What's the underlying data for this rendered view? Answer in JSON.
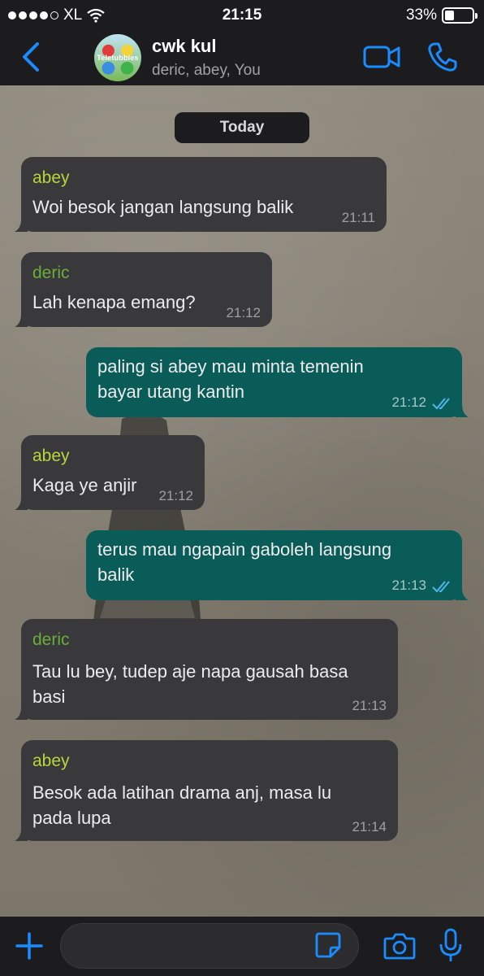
{
  "status_bar": {
    "carrier": "XL",
    "time": "21:15",
    "battery_percent": "33%",
    "battery_level": 0.33,
    "signal_bars": 4,
    "icons": [
      "signal-dots-icon",
      "wifi-icon",
      "battery-icon"
    ]
  },
  "header": {
    "back_icon": "chevron-left-icon",
    "avatar_text": "Teletubbies",
    "title": "cwk kul",
    "subtitle": "deric, abey, You",
    "video_icon": "video-camera-icon",
    "call_icon": "phone-icon"
  },
  "date_divider": "Today",
  "messages": [
    {
      "direction": "in",
      "sender": "abey",
      "sender_color": "#b7d63b",
      "text_lines": [
        "Woi besok jangan langsung balik"
      ],
      "time": "21:11"
    },
    {
      "direction": "in",
      "sender": "deric",
      "sender_color": "#6aad3a",
      "text_lines": [
        "Lah kenapa emang?"
      ],
      "time": "21:12"
    },
    {
      "direction": "out",
      "text_lines": [
        "paling si abey mau minta temenin",
        "bayar utang kantin"
      ],
      "time": "21:12",
      "status": "read"
    },
    {
      "direction": "in",
      "sender": "abey",
      "sender_color": "#b7d63b",
      "text_lines": [
        "Kaga ye anjir"
      ],
      "time": "21:12"
    },
    {
      "direction": "out",
      "text_lines": [
        "terus mau ngapain gaboleh langsung",
        "balik"
      ],
      "time": "21:13",
      "status": "read"
    },
    {
      "direction": "in",
      "sender": "deric",
      "sender_color": "#6aad3a",
      "text_lines": [
        "Tau lu bey, tudep aje napa gausah basa",
        "basi"
      ],
      "time": "21:13"
    },
    {
      "direction": "in",
      "sender": "abey",
      "sender_color": "#b7d63b",
      "text_lines": [
        "Besok ada latihan drama anj, masa lu",
        "pada lupa"
      ],
      "time": "21:14"
    }
  ],
  "composer": {
    "input_value": "",
    "placeholder": "",
    "icons": [
      "plus-icon",
      "sticker-icon",
      "camera-icon",
      "microphone-icon"
    ]
  },
  "colors": {
    "accent": "#1a8cff",
    "outgoing_bubble": "#0a5c58",
    "incoming_bubble": "#39393b",
    "read_ticks": "#4fb6ec"
  }
}
